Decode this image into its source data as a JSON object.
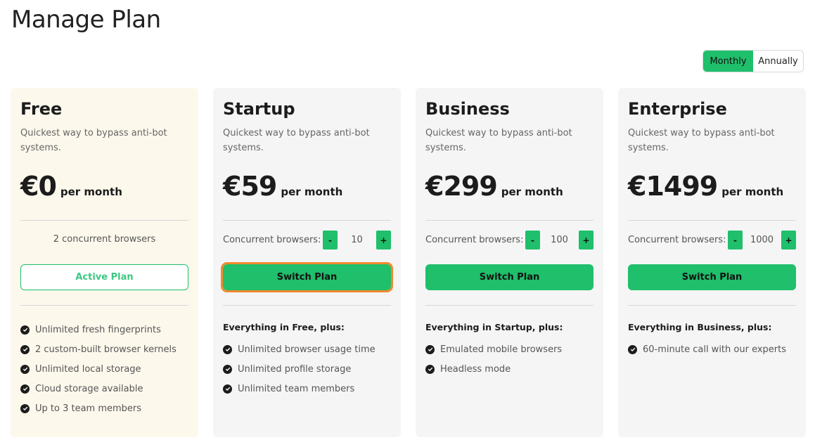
{
  "page": {
    "title": "Manage Plan"
  },
  "billing_toggle": {
    "options": [
      "Monthly",
      "Annually"
    ],
    "selected": "Monthly"
  },
  "colors": {
    "accent": "#1fbf6b",
    "free_card_bg": "#fdf8ec",
    "card_bg": "#f5f5f5",
    "highlight_outline": "#f08a2c"
  },
  "plans": [
    {
      "name": "Free",
      "description": "Quickest way to bypass anti-bot systems.",
      "price": "€0",
      "period": "per month",
      "concurrent_text": "2 concurrent browsers",
      "button_label": "Active Plan",
      "features_heading": "",
      "features": [
        "Unlimited fresh fingerprints",
        "2 custom-built browser kernels",
        "Unlimited local storage",
        "Cloud storage available",
        "Up to 3 team members"
      ]
    },
    {
      "name": "Startup",
      "description": "Quickest way to bypass anti-bot systems.",
      "price": "€59",
      "period": "per month",
      "concurrent_label": "Concurrent browsers:",
      "concurrent_value": "10",
      "minus_label": "-",
      "plus_label": "+",
      "button_label": "Switch Plan",
      "features_heading": "Everything in Free, plus:",
      "features": [
        "Unlimited browser usage time",
        "Unlimited profile storage",
        "Unlimited team members"
      ]
    },
    {
      "name": "Business",
      "description": "Quickest way to bypass anti-bot systems.",
      "price": "€299",
      "period": "per month",
      "concurrent_label": "Concurrent browsers:",
      "concurrent_value": "100",
      "minus_label": "-",
      "plus_label": "+",
      "button_label": "Switch Plan",
      "features_heading": "Everything in Startup, plus:",
      "features": [
        "Emulated mobile browsers",
        "Headless mode"
      ]
    },
    {
      "name": "Enterprise",
      "description": "Quickest way to bypass anti-bot systems.",
      "price": "€1499",
      "period": "per month",
      "concurrent_label": "Concurrent browsers:",
      "concurrent_value": "1000",
      "minus_label": "-",
      "plus_label": "+",
      "button_label": "Switch Plan",
      "features_heading": "Everything in Business, plus:",
      "features": [
        "60-minute call with our experts"
      ]
    }
  ]
}
